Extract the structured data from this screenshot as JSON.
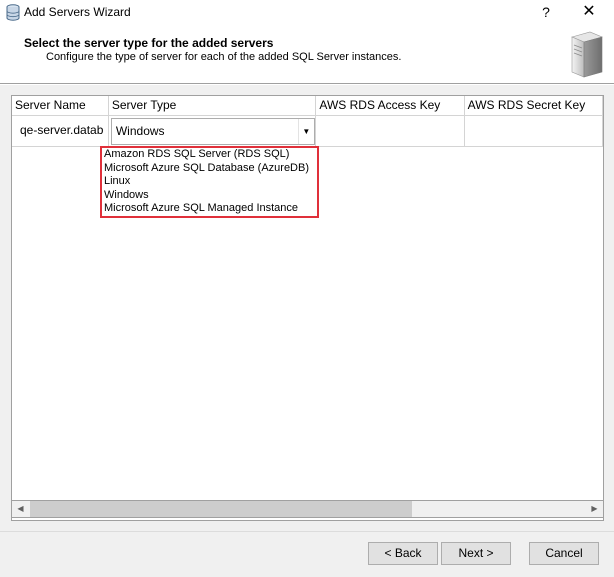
{
  "window": {
    "title": "Add Servers Wizard",
    "help_label": "?",
    "close_label": "✕"
  },
  "header": {
    "title": "Select the server type for the added servers",
    "subtitle": "Configure the type of server for each of the added SQL Server instances."
  },
  "grid": {
    "columns": [
      "Server Name",
      "Server Type",
      "AWS RDS Access Key",
      "AWS RDS Secret Key"
    ],
    "row": {
      "server_name": "qe-server.datab",
      "server_type": "Windows",
      "access_key": "",
      "secret_key": ""
    }
  },
  "dropdown": {
    "options": [
      "Amazon RDS SQL Server (RDS SQL)",
      "Microsoft Azure SQL Database (AzureDB)",
      "Linux",
      "Windows",
      "Microsoft Azure SQL Managed Instance"
    ],
    "highlight_color": "#e0303a"
  },
  "scrollbar": {
    "left_glyph": "◀",
    "right_glyph": "▶"
  },
  "buttons": {
    "back": "< Back",
    "next": "Next >",
    "cancel": "Cancel"
  },
  "icons": {
    "app": "database-server-icon",
    "header_image": "server-tower-icon",
    "dropdown_arrow": "▼"
  }
}
